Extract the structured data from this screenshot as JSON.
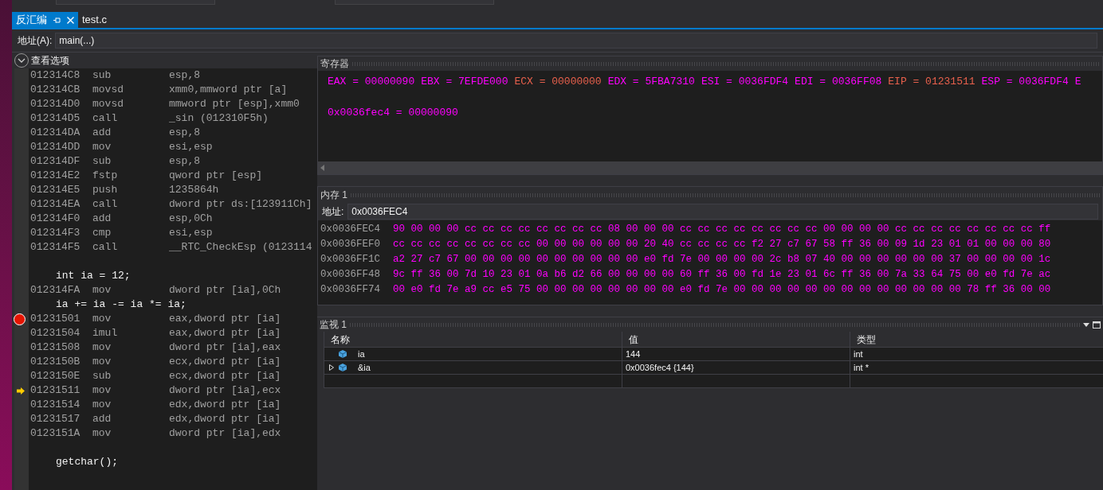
{
  "tabs": [
    {
      "label": "反汇编",
      "selected": true,
      "pinned": true
    },
    {
      "label": "test.c",
      "selected": false,
      "pinned": false
    }
  ],
  "address_bar": {
    "label": "地址(A):",
    "value": "main(...)"
  },
  "view_options": {
    "label": "查看选项",
    "expanded": false
  },
  "code_lines": [
    {
      "kind": "asm",
      "address": "012314C8",
      "op": "sub",
      "operand": "esp,8",
      "breakpoint": false,
      "current": false
    },
    {
      "kind": "asm",
      "address": "012314CB",
      "op": "movsd",
      "operand": "xmm0,mmword ptr [a]",
      "breakpoint": false,
      "current": false
    },
    {
      "kind": "asm",
      "address": "012314D0",
      "op": "movsd",
      "operand": "mmword ptr [esp],xmm0",
      "breakpoint": false,
      "current": false
    },
    {
      "kind": "asm",
      "address": "012314D5",
      "op": "call",
      "operand": "_sin (012310F5h)",
      "breakpoint": false,
      "current": false
    },
    {
      "kind": "asm",
      "address": "012314DA",
      "op": "add",
      "operand": "esp,8",
      "breakpoint": false,
      "current": false
    },
    {
      "kind": "asm",
      "address": "012314DD",
      "op": "mov",
      "operand": "esi,esp",
      "breakpoint": false,
      "current": false
    },
    {
      "kind": "asm",
      "address": "012314DF",
      "op": "sub",
      "operand": "esp,8",
      "breakpoint": false,
      "current": false
    },
    {
      "kind": "asm",
      "address": "012314E2",
      "op": "fstp",
      "operand": "qword ptr [esp]",
      "breakpoint": false,
      "current": false
    },
    {
      "kind": "asm",
      "address": "012314E5",
      "op": "push",
      "operand": "1235864h",
      "breakpoint": false,
      "current": false
    },
    {
      "kind": "asm",
      "address": "012314EA",
      "op": "call",
      "operand": "dword ptr ds:[123911Ch]",
      "breakpoint": false,
      "current": false
    },
    {
      "kind": "asm",
      "address": "012314F0",
      "op": "add",
      "operand": "esp,0Ch",
      "breakpoint": false,
      "current": false
    },
    {
      "kind": "asm",
      "address": "012314F3",
      "op": "cmp",
      "operand": "esi,esp",
      "breakpoint": false,
      "current": false
    },
    {
      "kind": "asm",
      "address": "012314F5",
      "op": "call",
      "operand": "__RTC_CheckEsp (0123114",
      "breakpoint": false,
      "current": false
    },
    {
      "kind": "blank"
    },
    {
      "kind": "source",
      "text": "int ia = 12;"
    },
    {
      "kind": "asm",
      "address": "012314FA",
      "op": "mov",
      "operand": "dword ptr [ia],0Ch",
      "breakpoint": false,
      "current": false
    },
    {
      "kind": "source",
      "text": "ia += ia -= ia *= ia;"
    },
    {
      "kind": "asm",
      "address": "01231501",
      "op": "mov",
      "operand": "eax,dword ptr [ia]",
      "breakpoint": true,
      "current": false
    },
    {
      "kind": "asm",
      "address": "01231504",
      "op": "imul",
      "operand": "eax,dword ptr [ia]",
      "breakpoint": false,
      "current": false
    },
    {
      "kind": "asm",
      "address": "01231508",
      "op": "mov",
      "operand": "dword ptr [ia],eax",
      "breakpoint": false,
      "current": false
    },
    {
      "kind": "asm",
      "address": "0123150B",
      "op": "mov",
      "operand": "ecx,dword ptr [ia]",
      "breakpoint": false,
      "current": false
    },
    {
      "kind": "asm",
      "address": "0123150E",
      "op": "sub",
      "operand": "ecx,dword ptr [ia]",
      "breakpoint": false,
      "current": false
    },
    {
      "kind": "asm",
      "address": "01231511",
      "op": "mov",
      "operand": "dword ptr [ia],ecx",
      "breakpoint": false,
      "current": true
    },
    {
      "kind": "asm",
      "address": "01231514",
      "op": "mov",
      "operand": "edx,dword ptr [ia]",
      "breakpoint": false,
      "current": false
    },
    {
      "kind": "asm",
      "address": "01231517",
      "op": "add",
      "operand": "edx,dword ptr [ia]",
      "breakpoint": false,
      "current": false
    },
    {
      "kind": "asm",
      "address": "0123151A",
      "op": "mov",
      "operand": "dword ptr [ia],edx",
      "breakpoint": false,
      "current": false
    },
    {
      "kind": "blank"
    },
    {
      "kind": "source",
      "text": "getchar();"
    }
  ],
  "registers": {
    "title": "寄存器",
    "items": [
      {
        "text": "EAX = 00000090",
        "changed": false
      },
      {
        "text": "EBX = 7EFDE000",
        "changed": false
      },
      {
        "text": "ECX = 00000000",
        "changed": true
      },
      {
        "text": "EDX = 5FBA7310",
        "changed": false
      },
      {
        "text": "ESI = 0036FDF4",
        "changed": false
      },
      {
        "text": "EDI = 0036FF08",
        "changed": false
      },
      {
        "text": "EIP = 01231511",
        "changed": true
      },
      {
        "text": "ESP = 0036FDF4",
        "changed": false
      },
      {
        "text": "E",
        "changed": false
      }
    ],
    "watch_expression": "0x0036fec4 = 00000090"
  },
  "memory": {
    "title": "内存 1",
    "address_label": "地址:",
    "address": "0x0036FEC4",
    "rows": [
      {
        "address": "0x0036FEC4",
        "bytes": "90 00 00 00 cc cc cc cc cc cc cc cc 08 00 00 00 cc cc cc cc cc cc cc cc 00 00 00 00 cc cc cc cc cc cc cc cc ff"
      },
      {
        "address": "0x0036FEF0",
        "bytes": "cc cc cc cc cc cc cc cc 00 00 00 00 00 00 20 40 cc cc cc cc f2 27 c7 67 58 ff 36 00 09 1d 23 01 01 00 00 00 80"
      },
      {
        "address": "0x0036FF1C",
        "bytes": "a2 27 c7 67 00 00 00 00 00 00 00 00 00 00 e0 fd 7e 00 00 00 00 2c b8 07 40 00 00 00 00 00 00 37 00 00 00 00 1c"
      },
      {
        "address": "0x0036FF48",
        "bytes": "9c ff 36 00 7d 10 23 01 0a b6 d2 66 00 00 00 00 60 ff 36 00 fd 1e 23 01 6c ff 36 00 7a 33 64 75 00 e0 fd 7e ac"
      },
      {
        "address": "0x0036FF74",
        "bytes": "00 e0 fd 7e a9 cc e5 75 00 00 00 00 00 00 00 00 e0 fd 7e 00 00 00 00 00 00 00 00 00 00 00 00 00 78 ff 36 00 00"
      }
    ]
  },
  "watch": {
    "title": "监视 1",
    "columns": [
      "名称",
      "值",
      "类型"
    ],
    "rows": [
      {
        "name": "ia",
        "value": "144",
        "type": "int",
        "expandable": false
      },
      {
        "name": "&ia",
        "value": "0x0036fec4 {144}",
        "type": "int *",
        "expandable": true
      }
    ]
  }
}
